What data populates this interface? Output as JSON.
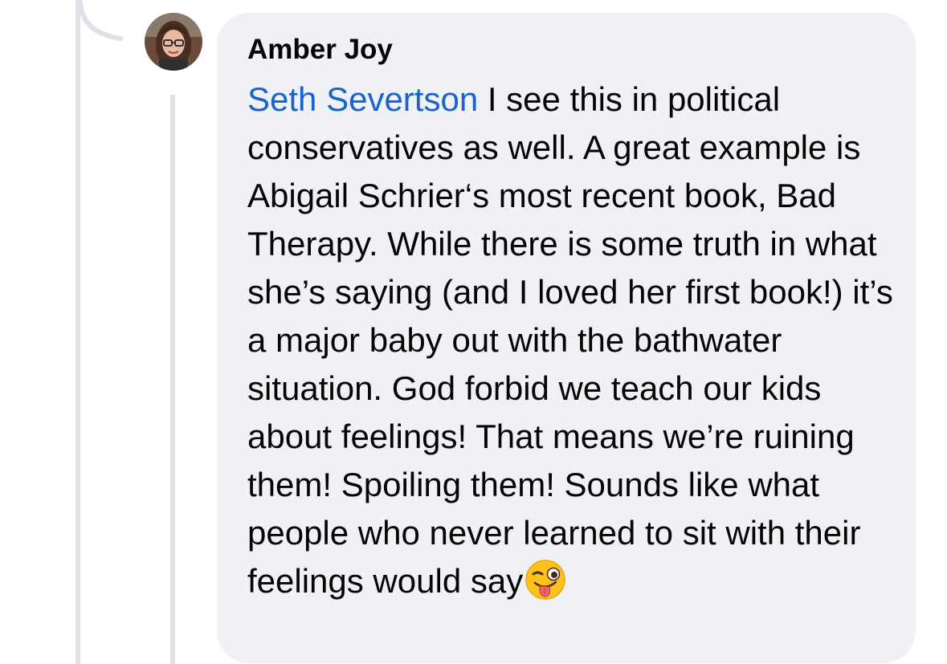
{
  "comment": {
    "author": "Amber Joy",
    "mention": "Seth Severtson",
    "text": " I see this in political conservatives as well. A great example is Abigail Schrier‘s most recent book, Bad Therapy. While there is some truth in what she’s saying (and I loved her first book!) it’s a major baby out with the bathwater situation. God forbid we teach our kids about feelings! That means we’re ruining them! Spoiling them! Sounds like what people who never learned to sit with their feelings would say",
    "emoji": "winking-face-with-tongue",
    "colors": {
      "mention": "#1763cf",
      "bubble": "#f0f1f5",
      "text": "#050505",
      "thread_line": "#dfe1e6"
    }
  }
}
